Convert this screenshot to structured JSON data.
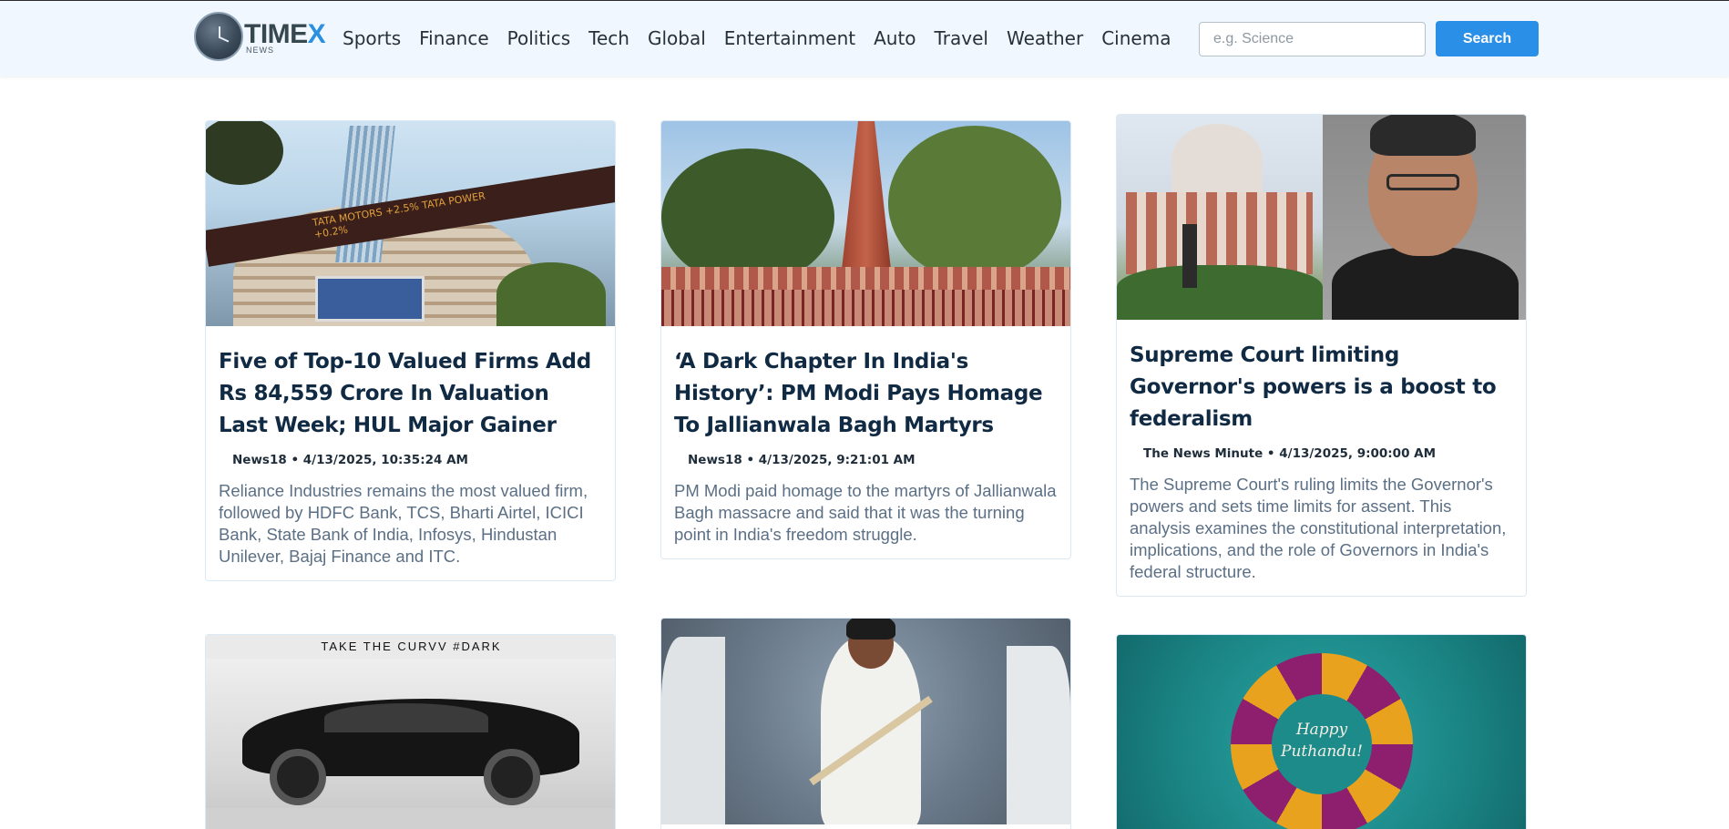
{
  "brand": {
    "logo_main": "TIME",
    "logo_x": "X",
    "logo_sub": "NEWS"
  },
  "nav": {
    "items": [
      "Sports",
      "Finance",
      "Politics",
      "Tech",
      "Global",
      "Entertainment",
      "Auto",
      "Travel",
      "Weather",
      "Cinema"
    ]
  },
  "search": {
    "placeholder": "e.g. Science",
    "button_label": "Search"
  },
  "articles": [
    {
      "title": "Five of Top-10 Valued Firms Add Rs 84,559 Crore In Valuation Last Week; HUL Major Gainer",
      "meta": "News18 • 4/13/2025, 10:35:24 AM",
      "description": "Reliance Industries remains the most valued firm, followed by HDFC Bank, TCS, Bharti Airtel, ICICI Bank, State Bank of India, Infosys, Hindustan Unilever, Bajaj Finance and ITC.",
      "image_ticker": "TATA MOTORS +2.5%  TATA POWER +0.2%"
    },
    {
      "title": "‘A Dark Chapter In India's History’: PM Modi Pays Homage To Jallianwala Bagh Martyrs",
      "meta": "News18 • 4/13/2025, 9:21:01 AM",
      "description": "PM Modi paid homage to the martyrs of Jallianwala Bagh massacre and said that it was the turning point in India's freedom struggle."
    },
    {
      "title": "Supreme Court limiting Governor's powers is a boost to federalism",
      "meta": "The News Minute • 4/13/2025, 9:00:00 AM",
      "description": "The Supreme Court's ruling limits the Governor's powers and sets time limits for assent. This analysis examines the constitutional interpretation, implications, and the role of Governors in India's federal structure."
    },
    {
      "image_banner": "TAKE THE CURVV #DARK"
    },
    {},
    {
      "image_text_1": "Happy",
      "image_text_2": "Puthandu!"
    }
  ],
  "colors": {
    "navbar_bg": "#f0f7fe",
    "accent": "#2a8fe6",
    "title_text": "#102a43",
    "description_text": "#5b6f85"
  }
}
